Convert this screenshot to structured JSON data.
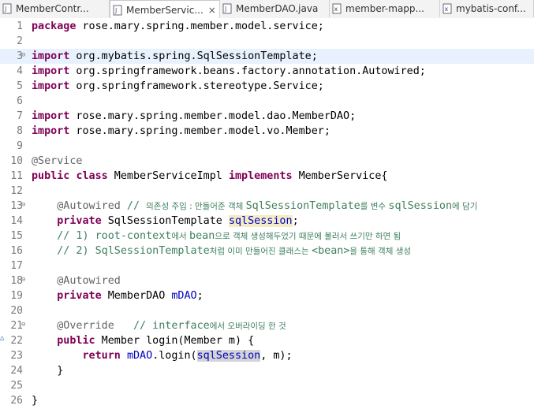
{
  "tabs": [
    {
      "label": "MemberContr...",
      "icon": "java-file-icon",
      "active": false
    },
    {
      "label": "MemberServic...",
      "icon": "java-file-icon",
      "active": true
    },
    {
      "label": "MemberDAO.java",
      "icon": "java-file-icon",
      "active": false
    },
    {
      "label": "member-mapp...",
      "icon": "xml-file-icon",
      "active": false
    },
    {
      "label": "mybatis-conf...",
      "icon": "xml-file-icon",
      "active": false
    }
  ],
  "close_glyph": "×",
  "line_numbers": [
    "1",
    "2",
    "3",
    "4",
    "5",
    "6",
    "7",
    "8",
    "9",
    "10",
    "11",
    "12",
    "13",
    "14",
    "15",
    "16",
    "17",
    "18",
    "19",
    "20",
    "21",
    "22",
    "23",
    "24",
    "25",
    "26"
  ],
  "code": {
    "l1": {
      "kw": "package",
      "rest": " rose.mary.spring.member.model.service;"
    },
    "l3": {
      "kw": "import",
      "rest": " org.mybatis.spring.SqlSessionTemplate;"
    },
    "l4": {
      "kw": "import",
      "rest": " org.springframework.beans.factory.annotation.Autowired;"
    },
    "l5": {
      "kw": "import",
      "rest": " org.springframework.stereotype.Service;"
    },
    "l7": {
      "kw": "import",
      "rest": " rose.mary.spring.member.model.dao.MemberDAO;"
    },
    "l8": {
      "kw": "import",
      "rest": " rose.mary.spring.member.model.vo.Member;"
    },
    "l10": {
      "ann": "@Service"
    },
    "l11": {
      "kw1": "public",
      "kw2": "class",
      "name": " MemberServiceImpl ",
      "kw3": "implements",
      "rest": " MemberService{"
    },
    "l13": {
      "ann": "@Autowired",
      "comment_a": " // ",
      "comment_b": "의존성 주입 : 만들어준 객체 ",
      "comment_c": "SqlSessionTemplate",
      "comment_d": "를 변수 ",
      "comment_e": "sqlSession",
      "comment_f": "에 담기"
    },
    "l14": {
      "kw": "private",
      "type": " SqlSessionTemplate ",
      "field": "sqlSession",
      "end": ";"
    },
    "l15": {
      "c1": "// 1) root-context",
      "c2": "에서 ",
      "c3": "bean",
      "c4": "으로 객체 생성해두었기 때문에 불러서 쓰기만 하면 됨"
    },
    "l16": {
      "c1": "// 2) SqlSessionTemplate",
      "c2": "처럼 이미 만들어진 클래스는 ",
      "c3": "<bean>",
      "c4": "을 통해 객체 생성"
    },
    "l18": {
      "ann": "@Autowired"
    },
    "l19": {
      "kw": "private",
      "type": " MemberDAO ",
      "field": "mDAO",
      "end": ";"
    },
    "l21": {
      "ann": "@Override",
      "c1": "   // interface",
      "c2": "에서 오버라이딩 한 것"
    },
    "l22": {
      "kw": "public",
      "rest": " Member login(Member m) {"
    },
    "l23": {
      "kw": "return",
      "field1": "mDAO",
      "mid": ".login(",
      "field2": "sqlSession",
      "end": ", m);"
    },
    "l24": {
      "text": "}"
    },
    "l26": {
      "text": "}"
    }
  },
  "colors": {
    "keyword": "#7f0055",
    "annotation": "#646464",
    "comment": "#3f7f5f",
    "field": "#0000c0",
    "current_line": "#e8f2fe"
  }
}
